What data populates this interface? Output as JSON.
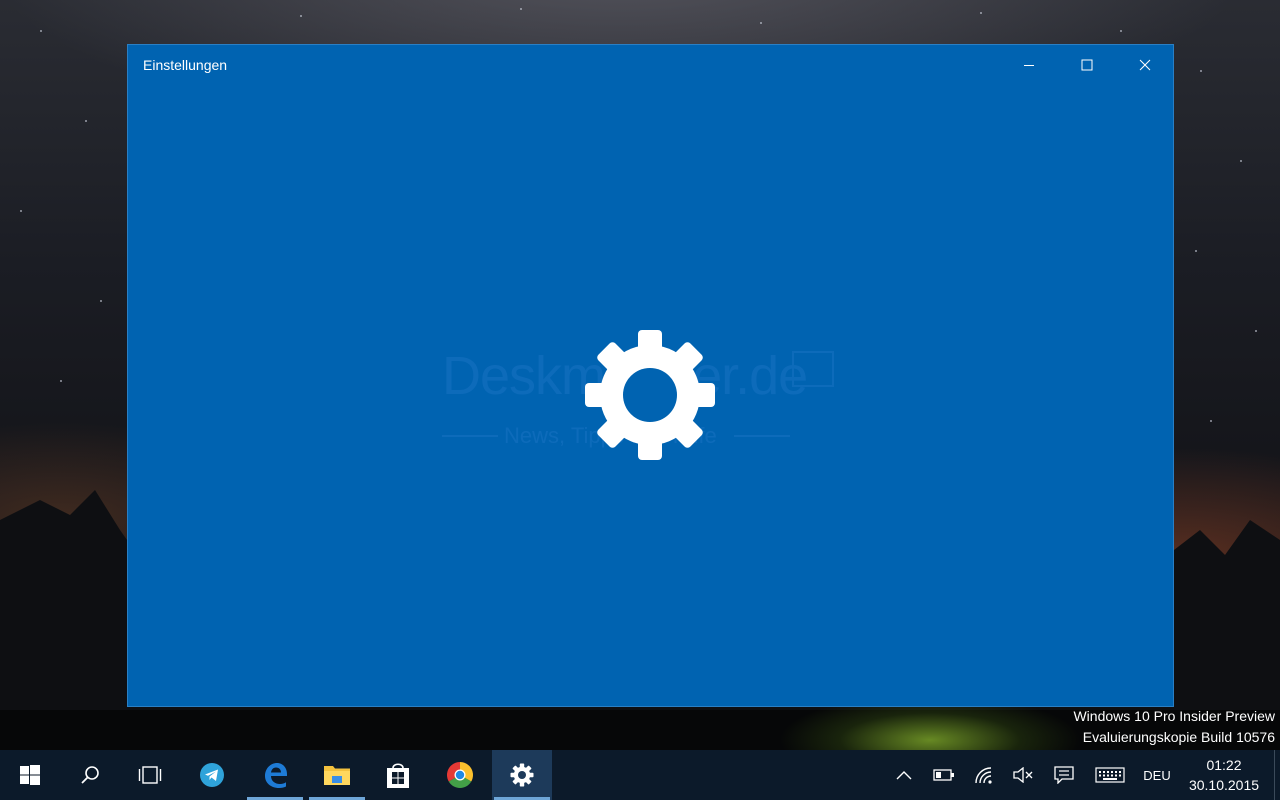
{
  "window": {
    "title": "Einstellungen",
    "background_color": "#0063b1",
    "splash_icon": "gear-icon",
    "watermark_text": "Deskmodder.de",
    "watermark_subtitle": "News, Tipps und Hilfe"
  },
  "desktop": {
    "os_watermark_line1": "Windows 10 Pro Insider Preview",
    "os_watermark_line2": "Evaluierungskopie Build 10576"
  },
  "taskbar": {
    "pinned": [
      {
        "name": "start",
        "icon": "windows-logo-icon"
      },
      {
        "name": "search",
        "icon": "search-icon"
      },
      {
        "name": "task-view",
        "icon": "task-view-icon"
      },
      {
        "name": "telegram",
        "icon": "telegram-icon"
      },
      {
        "name": "edge",
        "icon": "edge-icon"
      },
      {
        "name": "file-explorer",
        "icon": "folder-icon"
      },
      {
        "name": "store",
        "icon": "store-icon"
      },
      {
        "name": "chrome",
        "icon": "chrome-icon"
      },
      {
        "name": "settings",
        "icon": "gear-icon"
      }
    ],
    "tray": {
      "language": "DEU",
      "time": "01:22",
      "date": "30.10.2015",
      "icons": [
        "chevron-up-icon",
        "battery-icon",
        "wifi-icon",
        "volume-muted-icon",
        "action-center-icon",
        "keyboard-icon"
      ]
    },
    "accent_color": "#6ea6d8"
  }
}
